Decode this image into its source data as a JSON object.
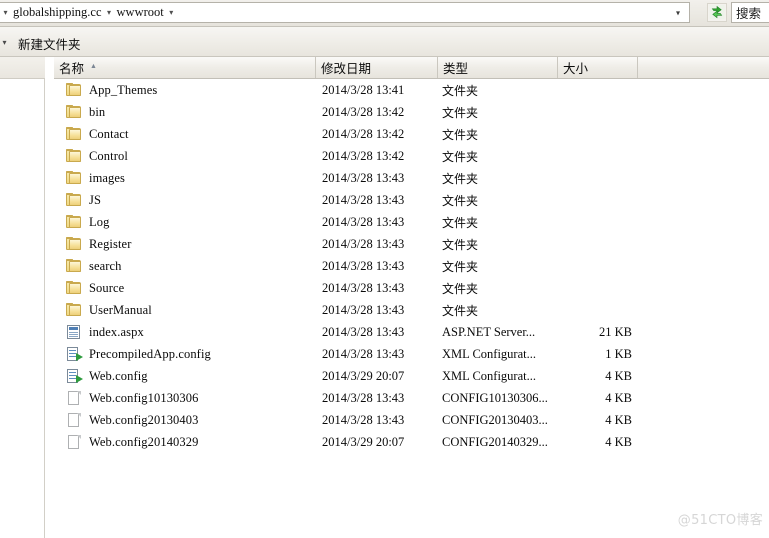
{
  "address_bar": {
    "breadcrumbs": [
      "globalshipping.cc",
      "wwwroot"
    ],
    "leading_arrow": "▾",
    "separator_arrow": "▾",
    "dropdown_arrow": "▾",
    "refresh_icon": "refresh-icon",
    "refresh_color": "#2fa42f"
  },
  "search": {
    "placeholder": "搜索",
    "value": ""
  },
  "toolbar": {
    "overflow_arrow": "▾",
    "new_folder_label": "新建文件夹"
  },
  "columns": {
    "name": "名称",
    "date_modified": "修改日期",
    "type": "类型",
    "size": "大小",
    "sort_column": "名称",
    "sort_direction": "ascending",
    "sort_caret": "▲"
  },
  "files": [
    {
      "name": "App_Themes",
      "icon": "folder-icon",
      "date": "2014/3/28 13:41",
      "type": "文件夹",
      "type_cjk": true,
      "size": ""
    },
    {
      "name": "bin",
      "icon": "folder-icon",
      "date": "2014/3/28 13:42",
      "type": "文件夹",
      "type_cjk": true,
      "size": ""
    },
    {
      "name": "Contact",
      "icon": "folder-icon",
      "date": "2014/3/28 13:42",
      "type": "文件夹",
      "type_cjk": true,
      "size": ""
    },
    {
      "name": "Control",
      "icon": "folder-icon",
      "date": "2014/3/28 13:42",
      "type": "文件夹",
      "type_cjk": true,
      "size": ""
    },
    {
      "name": "images",
      "icon": "folder-icon",
      "date": "2014/3/28 13:43",
      "type": "文件夹",
      "type_cjk": true,
      "size": ""
    },
    {
      "name": "JS",
      "icon": "folder-icon",
      "date": "2014/3/28 13:43",
      "type": "文件夹",
      "type_cjk": true,
      "size": ""
    },
    {
      "name": "Log",
      "icon": "folder-icon",
      "date": "2014/3/28 13:43",
      "type": "文件夹",
      "type_cjk": true,
      "size": ""
    },
    {
      "name": "Register",
      "icon": "folder-icon",
      "date": "2014/3/28 13:43",
      "type": "文件夹",
      "type_cjk": true,
      "size": ""
    },
    {
      "name": "search",
      "icon": "folder-icon",
      "date": "2014/3/28 13:43",
      "type": "文件夹",
      "type_cjk": true,
      "size": ""
    },
    {
      "name": "Source",
      "icon": "folder-icon",
      "date": "2014/3/28 13:43",
      "type": "文件夹",
      "type_cjk": true,
      "size": ""
    },
    {
      "name": "UserManual",
      "icon": "folder-icon",
      "date": "2014/3/28 13:43",
      "type": "文件夹",
      "type_cjk": true,
      "size": ""
    },
    {
      "name": "index.aspx",
      "icon": "aspx-icon",
      "date": "2014/3/28 13:43",
      "type": "ASP.NET Server...",
      "type_cjk": false,
      "size": "21 KB"
    },
    {
      "name": "PrecompiledApp.config",
      "icon": "config-icon",
      "date": "2014/3/28 13:43",
      "type": "XML Configurat...",
      "type_cjk": false,
      "size": "1 KB"
    },
    {
      "name": "Web.config",
      "icon": "config-icon",
      "date": "2014/3/29 20:07",
      "type": "XML Configurat...",
      "type_cjk": false,
      "size": "4 KB"
    },
    {
      "name": "Web.config10130306",
      "icon": "doc-icon",
      "date": "2014/3/28 13:43",
      "type": "CONFIG10130306...",
      "type_cjk": false,
      "size": "4 KB"
    },
    {
      "name": "Web.config20130403",
      "icon": "doc-icon",
      "date": "2014/3/28 13:43",
      "type": "CONFIG20130403...",
      "type_cjk": false,
      "size": "4 KB"
    },
    {
      "name": "Web.config20140329",
      "icon": "doc-icon",
      "date": "2014/3/29 20:07",
      "type": "CONFIG20140329...",
      "type_cjk": false,
      "size": "4 KB"
    }
  ],
  "watermark": {
    "text": "@51CTO博客"
  }
}
